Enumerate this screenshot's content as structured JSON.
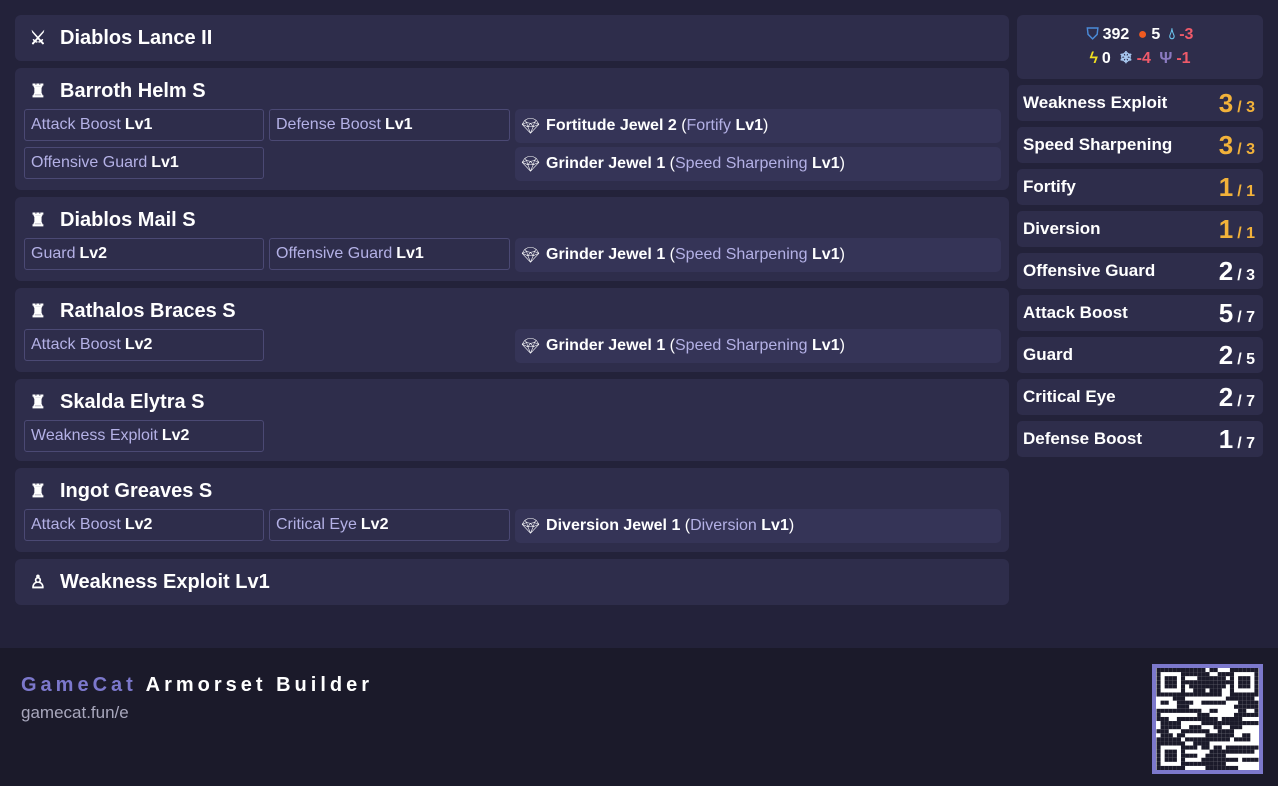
{
  "weapon": {
    "name": "Diablos Lance II",
    "icon": "lance-icon"
  },
  "armor": [
    {
      "name": "Barroth Helm S",
      "icon": "helm-icon",
      "skills": [
        {
          "name": "Attack Boost",
          "lv": "Lv1"
        },
        {
          "name": "Defense Boost",
          "lv": "Lv1"
        },
        {
          "name": "Offensive Guard",
          "lv": "Lv1"
        }
      ],
      "jewels": [
        {
          "name": "Fortitude Jewel 2",
          "skill": "Fortify",
          "lv": "Lv1"
        },
        {
          "name": "Grinder Jewel 1",
          "skill": "Speed Sharpening",
          "lv": "Lv1"
        }
      ]
    },
    {
      "name": "Diablos Mail S",
      "icon": "chest-icon",
      "skills": [
        {
          "name": "Guard",
          "lv": "Lv2"
        },
        {
          "name": "Offensive Guard",
          "lv": "Lv1"
        }
      ],
      "jewels": [
        {
          "name": "Grinder Jewel 1",
          "skill": "Speed Sharpening",
          "lv": "Lv1"
        }
      ]
    },
    {
      "name": "Rathalos Braces S",
      "icon": "arms-icon",
      "skills": [
        {
          "name": "Attack Boost",
          "lv": "Lv2"
        }
      ],
      "jewels": [
        {
          "name": "Grinder Jewel 1",
          "skill": "Speed Sharpening",
          "lv": "Lv1"
        }
      ]
    },
    {
      "name": "Skalda Elytra S",
      "icon": "waist-icon",
      "skills": [
        {
          "name": "Weakness Exploit",
          "lv": "Lv2"
        }
      ],
      "jewels": []
    },
    {
      "name": "Ingot Greaves S",
      "icon": "legs-icon",
      "skills": [
        {
          "name": "Attack Boost",
          "lv": "Lv2"
        },
        {
          "name": "Critical Eye",
          "lv": "Lv2"
        }
      ],
      "jewels": [
        {
          "name": "Diversion Jewel 1",
          "skill": "Diversion",
          "lv": "Lv1"
        }
      ]
    }
  ],
  "charm": {
    "name": "Weakness Exploit Lv1",
    "icon": "charm-icon"
  },
  "stats": {
    "defense": "392",
    "fire": "5",
    "water": "-3",
    "thunder": "0",
    "ice": "-4",
    "dragon": "-1"
  },
  "skills": [
    {
      "name": "Weakness Exploit",
      "level": "3",
      "max": "/ 3",
      "maxed": true
    },
    {
      "name": "Speed Sharpening",
      "level": "3",
      "max": "/ 3",
      "maxed": true
    },
    {
      "name": "Fortify",
      "level": "1",
      "max": "/ 1",
      "maxed": true
    },
    {
      "name": "Diversion",
      "level": "1",
      "max": "/ 1",
      "maxed": true
    },
    {
      "name": "Offensive Guard",
      "level": "2",
      "max": "/ 3",
      "maxed": false
    },
    {
      "name": "Attack Boost",
      "level": "5",
      "max": "/ 7",
      "maxed": false
    },
    {
      "name": "Guard",
      "level": "2",
      "max": "/ 5",
      "maxed": false
    },
    {
      "name": "Critical Eye",
      "level": "2",
      "max": "/ 7",
      "maxed": false
    },
    {
      "name": "Defense Boost",
      "level": "1",
      "max": "/ 7",
      "maxed": false
    }
  ],
  "footer": {
    "brand": "GameCat",
    "title": "Armorset Builder",
    "url": "gamecat.fun/e"
  },
  "colors": {
    "accent": "#7c78cc",
    "maxed": "#f2b23a",
    "negative": "#ef5a6a"
  }
}
